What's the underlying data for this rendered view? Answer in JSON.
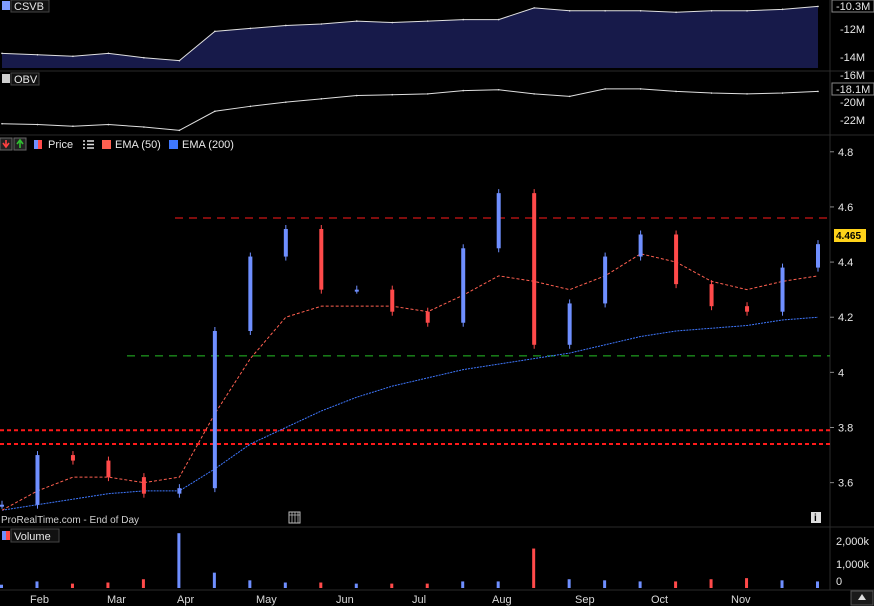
{
  "panels": {
    "csvb": {
      "label": "CSVB",
      "current": "-10.3M",
      "ticks": [
        "-12M",
        "-14M"
      ]
    },
    "obv": {
      "label": "OBV",
      "current": "-18.1M",
      "ticks": [
        "-16M",
        "-20M",
        "-22M"
      ]
    },
    "price": {
      "legend": {
        "price": "Price",
        "ema50": "EMA (50)",
        "ema200": "EMA (200)"
      },
      "last_price": "4.465",
      "watermark": "ProRealTime.com - End of Day"
    },
    "volume": {
      "label": "Volume",
      "ticks": [
        "2,000k",
        "1,000k",
        "0"
      ]
    }
  },
  "months": [
    "Feb",
    "Mar",
    "Apr",
    "May",
    "Jun",
    "Jul",
    "Aug",
    "Sep",
    "Oct",
    "Nov"
  ],
  "colors": {
    "up": "#6f8fff",
    "down": "#ff4a4a",
    "ema50": "#ff6050",
    "ema200": "#3f78ff",
    "hline_red": "#ff1a1a",
    "hline_green": "#25c025",
    "csvb_fill": "#171a4a",
    "last_price_bg": "#ffd31a"
  },
  "chart_data": [
    {
      "type": "area",
      "title": "CSVB",
      "x": [
        "Jan-15",
        "Feb-01",
        "Feb-15",
        "Mar-01",
        "Mar-15",
        "Mar-22",
        "Apr-01",
        "Apr-15",
        "May-01",
        "May-15",
        "Jun-01",
        "Jun-15",
        "Jul-01",
        "Jul-15",
        "Jul-25",
        "Aug-01",
        "Aug-15",
        "Sep-01",
        "Sep-15",
        "Oct-01",
        "Oct-15",
        "Nov-01",
        "Nov-15",
        "Nov-25"
      ],
      "values": [
        -13.5,
        -13.6,
        -13.7,
        -13.5,
        -13.8,
        -14.0,
        -12.0,
        -11.8,
        -11.6,
        -11.5,
        -11.3,
        -11.4,
        -11.3,
        -11.2,
        -11.2,
        -10.4,
        -10.6,
        -10.6,
        -10.6,
        -10.7,
        -10.6,
        -10.6,
        -10.5,
        -10.3
      ],
      "ylim": [
        -14.5,
        -10.0
      ],
      "ticks": [
        -12,
        -14
      ]
    },
    {
      "type": "line",
      "title": "OBV",
      "x": [
        "Jan-15",
        "Feb-01",
        "Feb-15",
        "Mar-01",
        "Mar-15",
        "Mar-22",
        "Apr-01",
        "Apr-15",
        "May-01",
        "May-15",
        "Jun-01",
        "Jun-15",
        "Jul-01",
        "Jul-15",
        "Jul-25",
        "Aug-01",
        "Aug-15",
        "Sep-01",
        "Sep-15",
        "Oct-01",
        "Oct-15",
        "Nov-01",
        "Nov-15",
        "Nov-25"
      ],
      "values": [
        -22.0,
        -22.1,
        -22.3,
        -22.1,
        -22.4,
        -22.8,
        -20.5,
        -19.9,
        -19.4,
        -19.0,
        -18.6,
        -18.5,
        -18.4,
        -18.0,
        -17.9,
        -18.4,
        -18.7,
        -17.8,
        -17.8,
        -18.1,
        -18.3,
        -18.4,
        -18.3,
        -18.1
      ],
      "ylim": [
        -23.0,
        -16.0
      ],
      "ticks": [
        -16,
        -20,
        -22
      ]
    },
    {
      "type": "candlestick",
      "title": "Price",
      "x": [
        "Jan-15",
        "Feb-01",
        "Feb-15",
        "Mar-01",
        "Mar-15",
        "Mar-22",
        "Apr-01",
        "Apr-15",
        "May-01",
        "May-15",
        "Jun-01",
        "Jun-15",
        "Jul-01",
        "Jul-15",
        "Jul-25",
        "Aug-01",
        "Aug-15",
        "Sep-01",
        "Sep-15",
        "Oct-01",
        "Oct-15",
        "Nov-01",
        "Nov-15",
        "Nov-25"
      ],
      "close": [
        3.52,
        3.7,
        3.68,
        3.62,
        3.56,
        3.58,
        4.15,
        4.42,
        4.52,
        4.3,
        4.3,
        4.22,
        4.18,
        4.45,
        4.65,
        4.1,
        4.25,
        4.42,
        4.5,
        4.32,
        4.24,
        4.22,
        4.38,
        4.465
      ],
      "ema50": [
        3.5,
        3.57,
        3.62,
        3.62,
        3.6,
        3.62,
        3.85,
        4.05,
        4.2,
        4.24,
        4.24,
        4.24,
        4.22,
        4.28,
        4.35,
        4.33,
        4.3,
        4.35,
        4.43,
        4.4,
        4.33,
        4.3,
        4.33,
        4.35
      ],
      "ema200": [
        3.5,
        3.52,
        3.54,
        3.56,
        3.57,
        3.57,
        3.65,
        3.74,
        3.8,
        3.86,
        3.91,
        3.95,
        3.98,
        4.01,
        4.03,
        4.05,
        4.07,
        4.1,
        4.13,
        4.15,
        4.16,
        4.17,
        4.19,
        4.2
      ],
      "hlines": [
        4.56,
        4.06,
        3.79,
        3.74
      ],
      "ylim": [
        3.45,
        4.85
      ],
      "ticks": [
        4.8,
        4.6,
        4.4,
        4.2,
        4,
        3.8,
        3.6
      ]
    },
    {
      "type": "bar",
      "title": "Volume",
      "x": [
        "Jan-15",
        "Feb-01",
        "Feb-15",
        "Mar-01",
        "Mar-15",
        "Mar-22",
        "Apr-01",
        "Apr-15",
        "May-01",
        "May-15",
        "Jun-01",
        "Jun-15",
        "Jul-01",
        "Jul-15",
        "Jul-25",
        "Aug-01",
        "Aug-15",
        "Sep-01",
        "Sep-15",
        "Oct-01",
        "Oct-15",
        "Nov-01",
        "Nov-15",
        "Nov-25"
      ],
      "values": [
        150,
        300,
        200,
        250,
        400,
        2500,
        700,
        350,
        250,
        250,
        200,
        200,
        200,
        300,
        300,
        1800,
        400,
        350,
        300,
        300,
        400,
        450,
        350,
        300
      ],
      "unit": "k",
      "ylim": [
        0,
        2600
      ],
      "ticks": [
        2000,
        1000,
        0
      ]
    }
  ]
}
